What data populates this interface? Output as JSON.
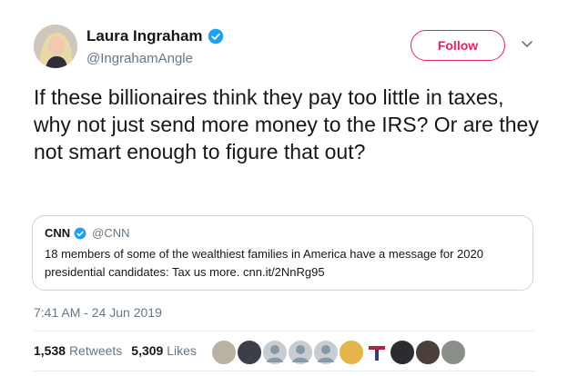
{
  "author": {
    "name": "Laura Ingraham",
    "handle": "@IngrahamAngle",
    "verified_icon": "verified-badge-icon"
  },
  "follow_label": "Follow",
  "tweet": {
    "text": "If these billionaires think they pay too little in taxes, why not just send more money to the IRS? Or are they not smart enough to figure that out?"
  },
  "quote": {
    "name": "CNN",
    "handle": "@CNN",
    "text": "18 members of some of the wealthiest families in America have a message for 2020 presidential candidates: Tax us more. cnn.it/2NnRg95"
  },
  "timestamp": "7:41 AM - 24 Jun 2019",
  "stats": {
    "retweets_count": "1,538",
    "retweets_label": "Retweets",
    "likes_count": "5,309",
    "likes_label": "Likes"
  },
  "colors": {
    "follow": "#e0245e",
    "verified": "#1da1f2",
    "muted_text": "#657786",
    "border": "#ccd6dd"
  }
}
